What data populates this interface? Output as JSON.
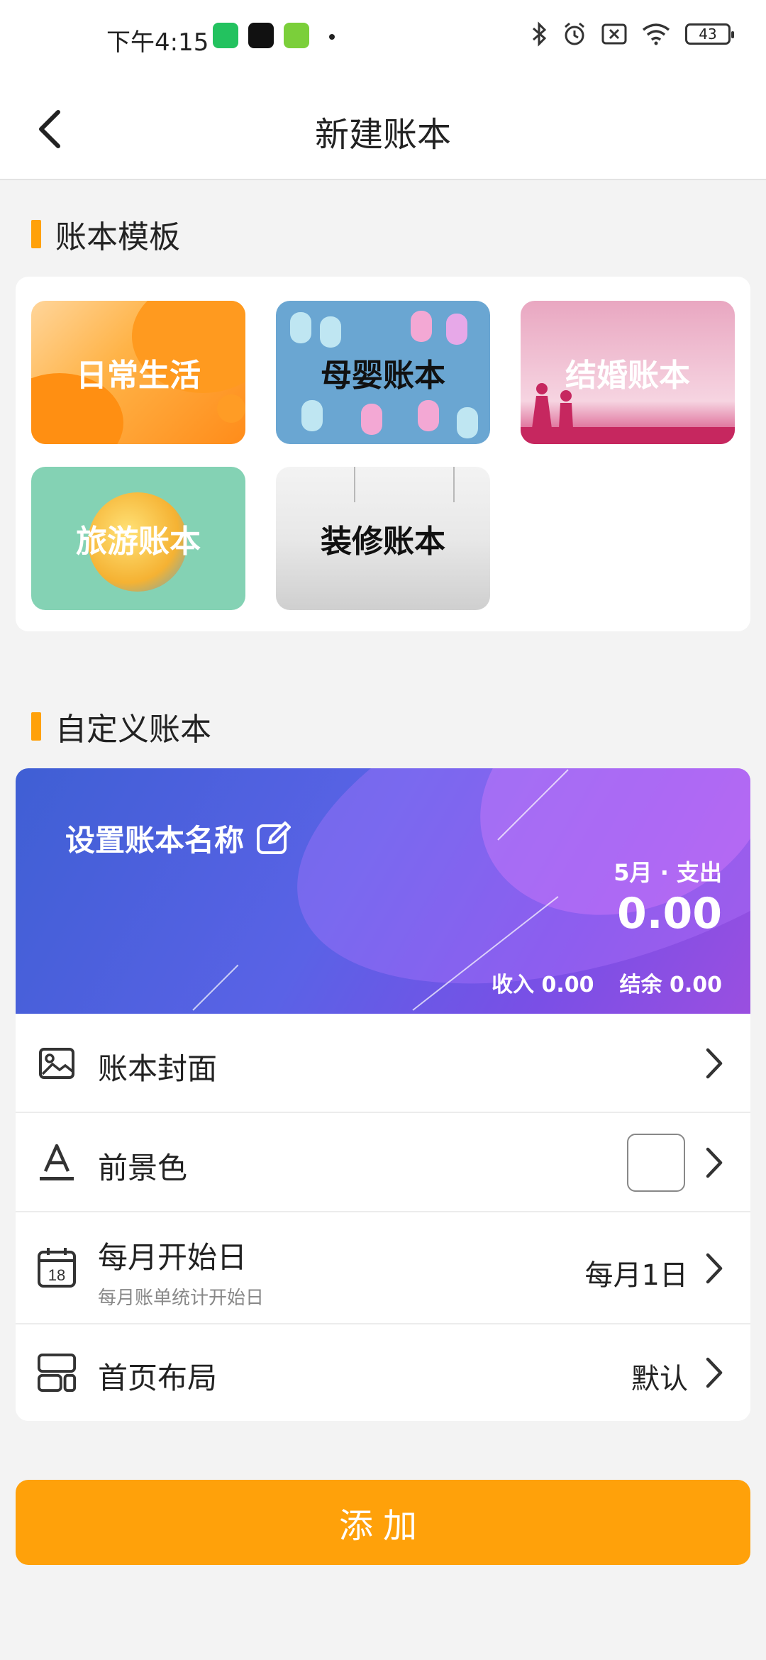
{
  "status_bar": {
    "time": "下午4:15",
    "battery": "43"
  },
  "header": {
    "title": "新建账本"
  },
  "templates_section": {
    "title": "账本模板",
    "items": [
      {
        "label": "日常生活",
        "label_color": "#ffffff"
      },
      {
        "label": "母婴账本",
        "label_color": "#111111"
      },
      {
        "label": "结婚账本",
        "label_color": "#ffffff"
      },
      {
        "label": "旅游账本",
        "label_color": "#ffffff"
      },
      {
        "label": "装修账本",
        "label_color": "#111111"
      }
    ]
  },
  "custom_section": {
    "title": "自定义账本",
    "cover": {
      "name_placeholder": "设置账本名称",
      "month_label": "5月 · 支出",
      "amount": "0.00",
      "income": "收入 0.00",
      "balance": "结余 0.00"
    },
    "rows": {
      "cover_image": {
        "label": "账本封面"
      },
      "foreground": {
        "label": "前景色"
      },
      "start_day": {
        "label": "每月开始日",
        "sublabel": "每月账单统计开始日",
        "value": "每月1日"
      },
      "layout": {
        "label": "首页布局",
        "value": "默认"
      }
    }
  },
  "add_button": {
    "label": "添加"
  },
  "colors": {
    "accent": "#ffa10a",
    "cover_start": "#3f5fd4",
    "cover_end": "#9a4fe0"
  }
}
